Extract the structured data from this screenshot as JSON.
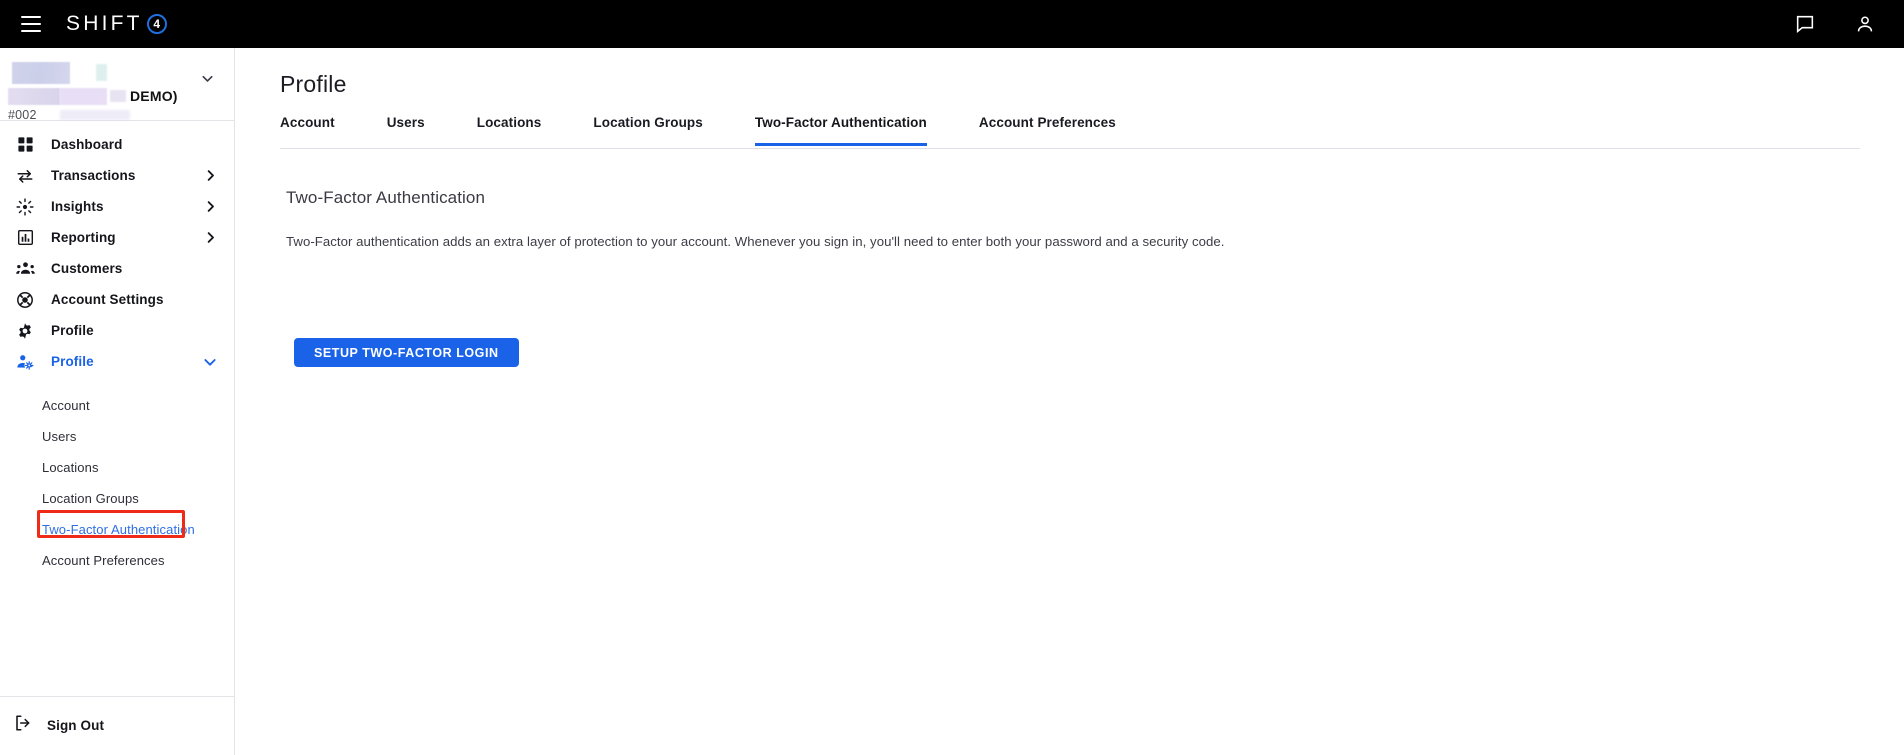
{
  "topbar": {
    "menu_icon": "hamburger-menu-icon",
    "brand_text": "SHIFT",
    "brand_badge": "4",
    "chat_icon": "chat-bubble-icon",
    "account_icon": "person-icon"
  },
  "account_switcher": {
    "demo_label": "DEMO)",
    "account_id": "#002",
    "chevron_icon": "chevron-down-icon"
  },
  "sidebar": {
    "items": [
      {
        "label": "Dashboard",
        "icon": "grid-icon",
        "expandable": false
      },
      {
        "label": "Transactions",
        "icon": "transfer-arrows-icon",
        "expandable": true
      },
      {
        "label": "Insights",
        "icon": "sparkle-icon",
        "expandable": true
      },
      {
        "label": "Reporting",
        "icon": "bar-chart-icon",
        "expandable": true
      },
      {
        "label": "Customers",
        "icon": "people-icon",
        "expandable": false
      },
      {
        "label": "Account Settings",
        "icon": "gear-icon",
        "expandable": false
      },
      {
        "label": "Profile",
        "icon": "user-gear-icon",
        "expandable": true
      }
    ],
    "subitems": [
      {
        "label": "Account"
      },
      {
        "label": "Users"
      },
      {
        "label": "Locations"
      },
      {
        "label": "Location Groups"
      },
      {
        "label": "Two-Factor Authentication"
      },
      {
        "label": "Account Preferences"
      }
    ],
    "signout": {
      "label": "Sign Out",
      "icon": "logout-icon"
    }
  },
  "main": {
    "page_title": "Profile",
    "tabs": [
      {
        "label": "Account"
      },
      {
        "label": "Users"
      },
      {
        "label": "Locations"
      },
      {
        "label": "Location Groups"
      },
      {
        "label": "Two-Factor Authentication"
      },
      {
        "label": "Account Preferences"
      }
    ],
    "section_title": "Two-Factor Authentication",
    "section_description": "Two-Factor authentication adds an extra layer of protection to your account. Whenever you sign in, you'll need to enter both your password and a security code.",
    "setup_button_label": "SETUP TWO-FACTOR LOGIN"
  },
  "colors": {
    "accent_blue": "#1a63e8",
    "topbar_black": "#000000",
    "highlight_red": "#ef2a17"
  }
}
